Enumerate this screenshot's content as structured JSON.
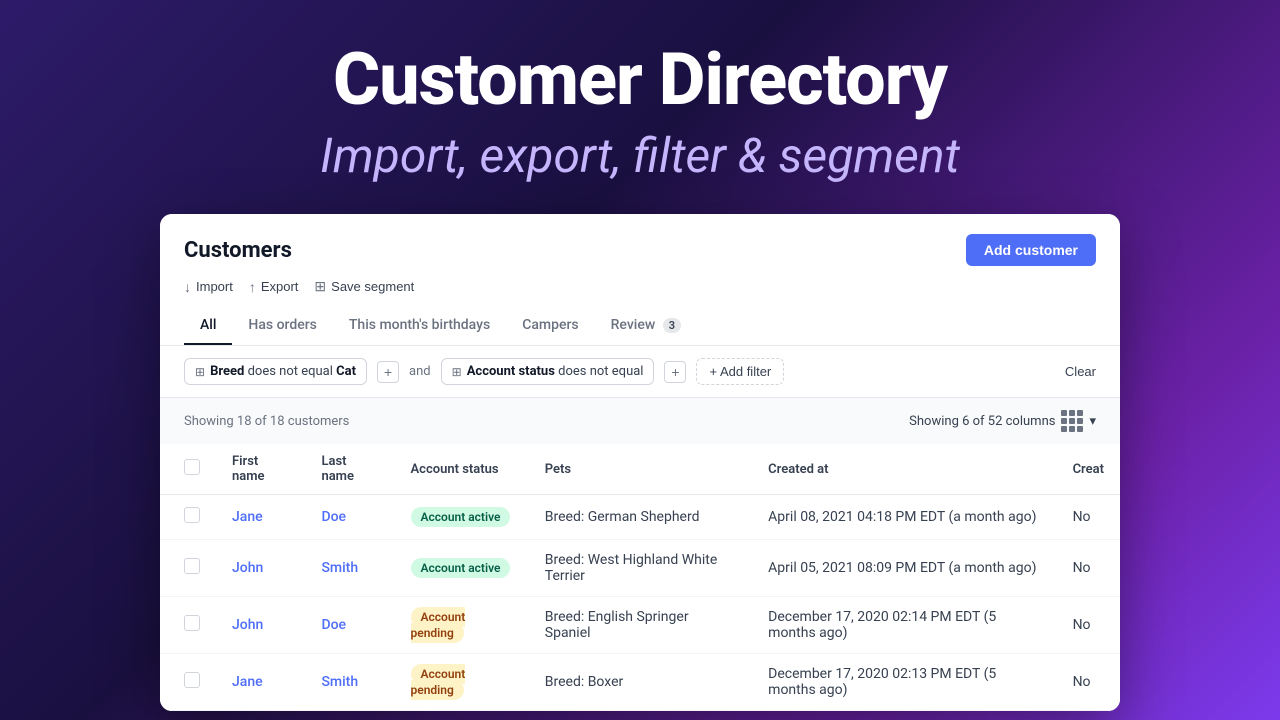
{
  "hero": {
    "title": "Customer Directory",
    "subtitle": "Import, export, filter & segment"
  },
  "panel": {
    "title": "Customers",
    "add_button": "Add customer",
    "actions": [
      {
        "label": "Import",
        "icon": "↓"
      },
      {
        "label": "Export",
        "icon": "↑"
      },
      {
        "label": "Save segment",
        "icon": "⊞"
      }
    ],
    "tabs": [
      {
        "label": "All",
        "active": true,
        "badge": null
      },
      {
        "label": "Has orders",
        "active": false,
        "badge": null
      },
      {
        "label": "This month's birthdays",
        "active": false,
        "badge": null
      },
      {
        "label": "Campers",
        "active": false,
        "badge": null
      },
      {
        "label": "Review",
        "active": false,
        "badge": "3"
      }
    ],
    "filters": {
      "filter1": {
        "field": "Breed",
        "operator": "does not equal",
        "value": "Cat"
      },
      "and_label": "and",
      "filter2": {
        "field": "Account status",
        "operator": "does not equal",
        "value": ""
      },
      "add_filter": "+ Add filter",
      "clear": "Clear"
    },
    "table": {
      "showing_text": "Showing 18 of 18 customers",
      "columns_text": "Showing 6 of 52 columns",
      "headers": [
        "First name",
        "Last name",
        "Account status",
        "Pets",
        "Created at",
        "Creat"
      ],
      "rows": [
        {
          "first_name": "Jane",
          "last_name": "Doe",
          "account_status": "Account active",
          "status_type": "active",
          "pets": "Breed: German Shepherd",
          "created_at": "April 08, 2021 04:18 PM EDT (a month ago)",
          "extra": "No"
        },
        {
          "first_name": "John",
          "last_name": "Smith",
          "account_status": "Account active",
          "status_type": "active",
          "pets": "Breed: West Highland White Terrier",
          "created_at": "April 05, 2021 08:09 PM EDT (a month ago)",
          "extra": "No"
        },
        {
          "first_name": "John",
          "last_name": "Doe",
          "account_status": "Account pending",
          "status_type": "pending",
          "pets": "Breed: English Springer Spaniel",
          "created_at": "December 17, 2020 02:14 PM EDT (5 months ago)",
          "extra": "No"
        },
        {
          "first_name": "Jane",
          "last_name": "Smith",
          "account_status": "Account pending",
          "status_type": "pending",
          "pets": "Breed: Boxer",
          "created_at": "December 17, 2020 02:13 PM EDT (5 months ago)",
          "extra": "No"
        }
      ]
    }
  }
}
